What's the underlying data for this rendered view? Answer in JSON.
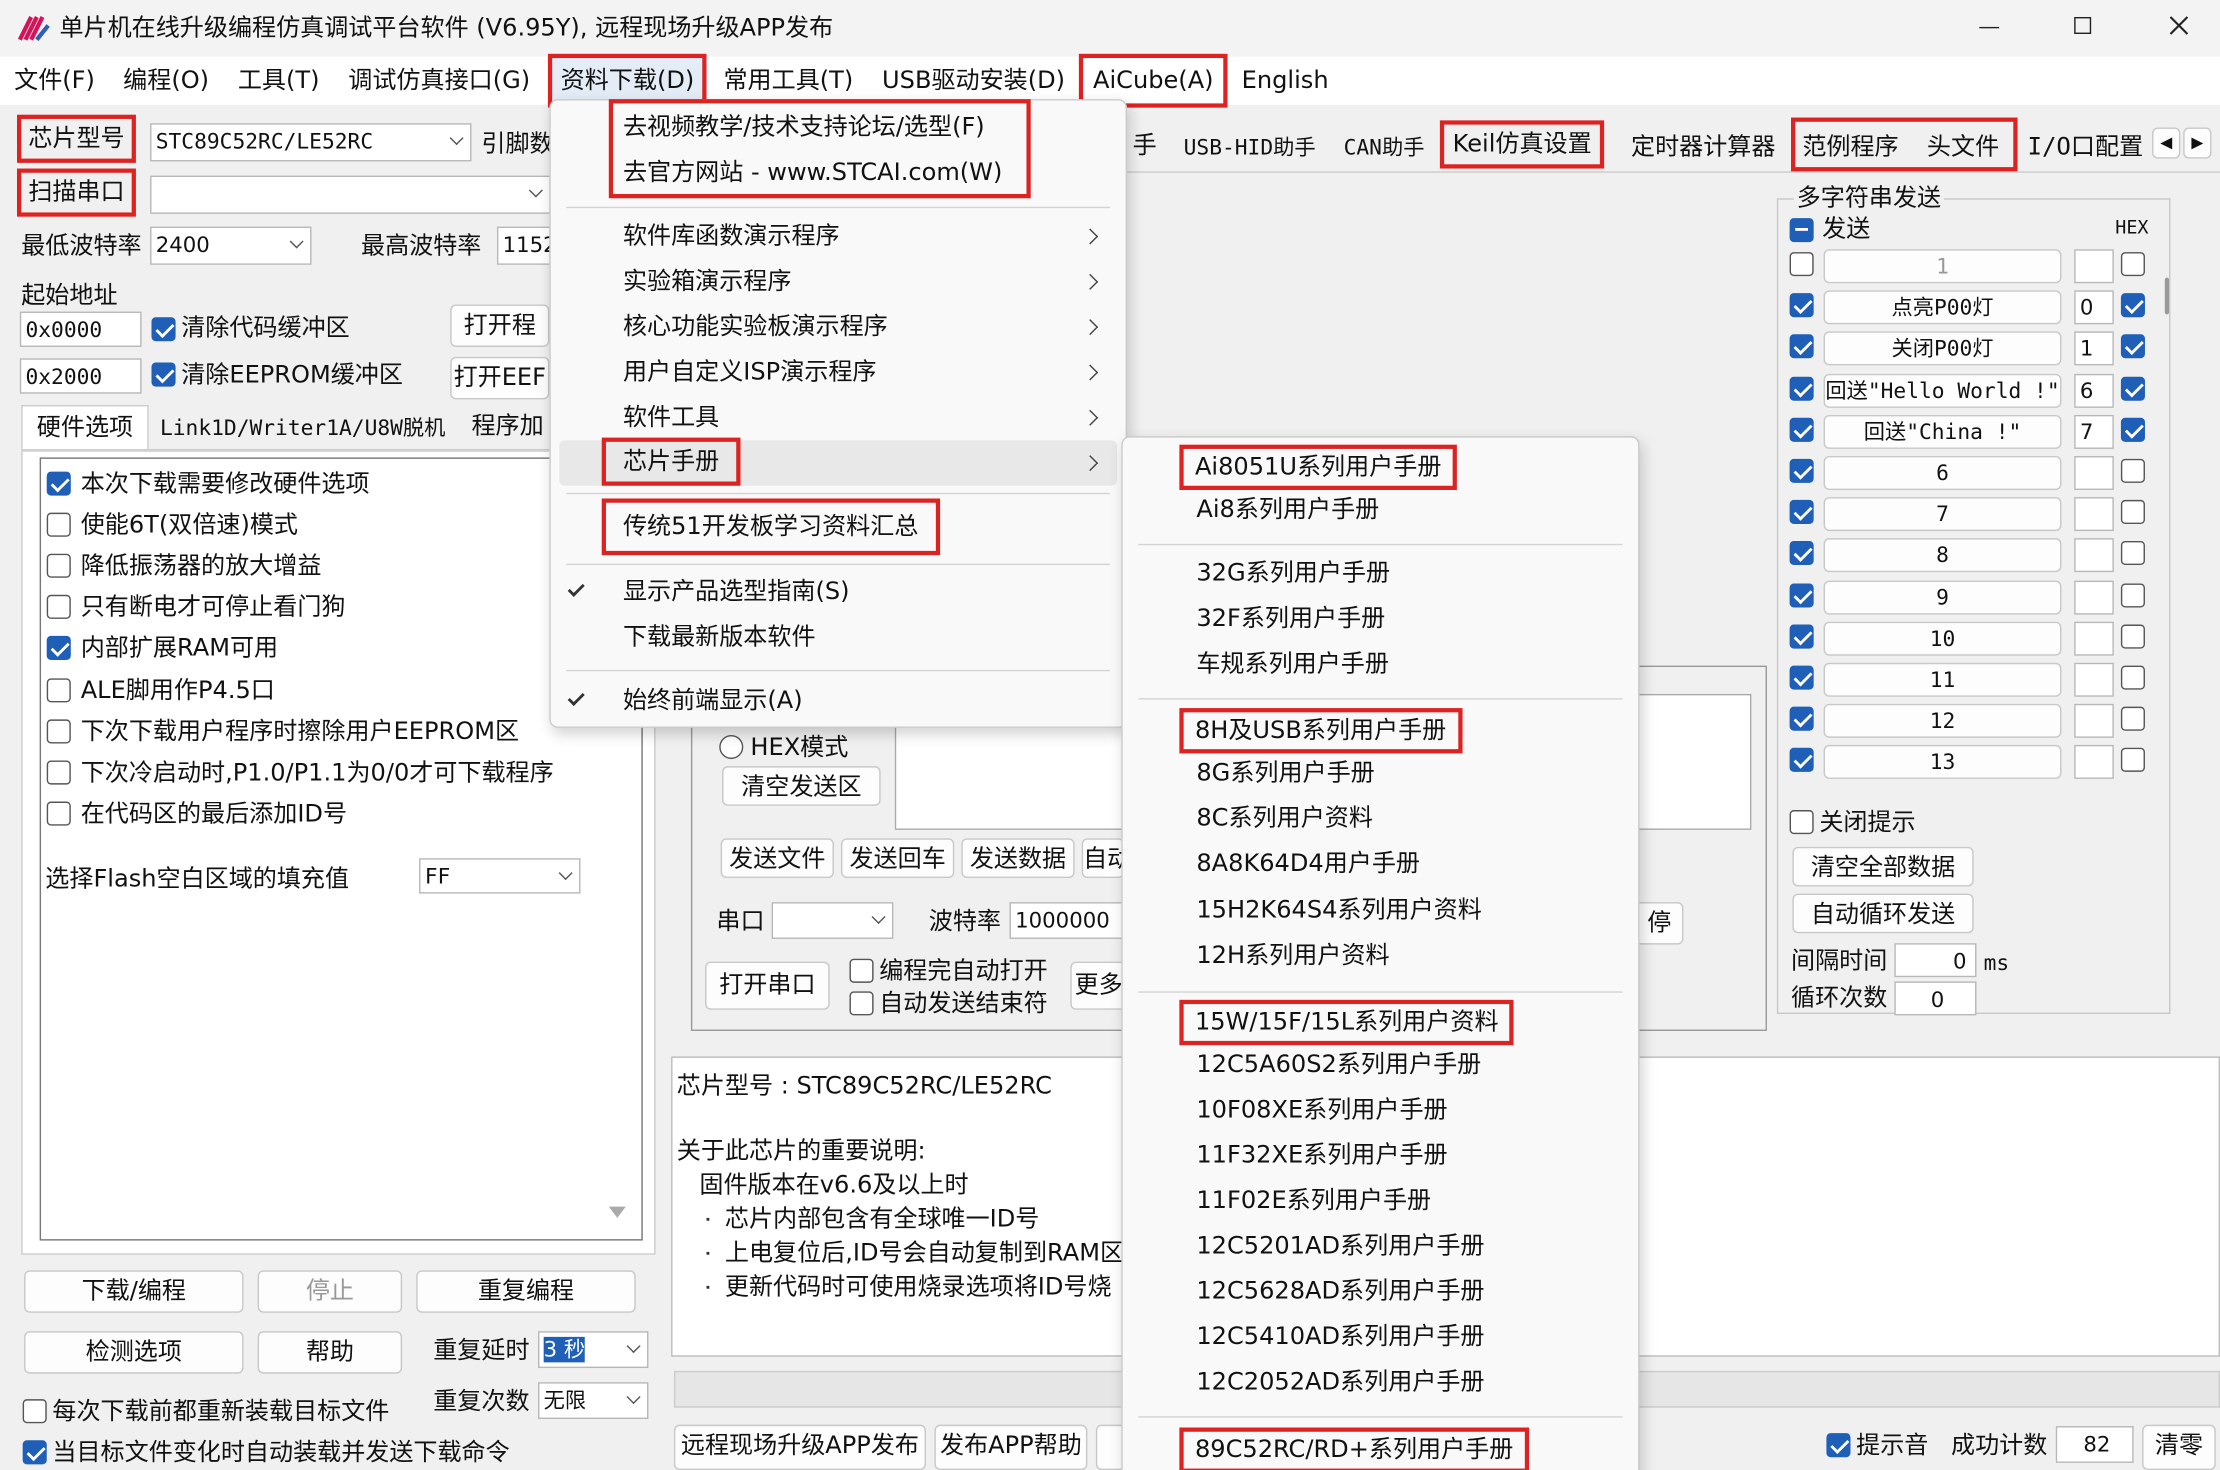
{
  "window": {
    "title": "单片机在线升级编程仿真调试平台软件 (V6.95Y), 远程现场升级APP发布"
  },
  "menubar": [
    "文件(F)",
    "编程(O)",
    "工具(T)",
    "调试仿真接口(G)",
    "资料下载(D)",
    "常用工具(T)",
    "USB驱动安装(D)",
    "AiCube(A)",
    "English"
  ],
  "left": {
    "chip_label": "芯片型号",
    "chip_value": "STC89C52RC/LE52RC",
    "pin_label": "引脚数",
    "scan_label": "扫描串口",
    "min_baud_label": "最低波特率",
    "min_baud": "2400",
    "max_baud_label": "最高波特率",
    "max_baud": "1152",
    "start_addr_label": "起始地址",
    "addr1": "0x0000",
    "clear_code": "清除代码缓冲区",
    "open_prog": "打开程",
    "addr2": "0x2000",
    "clear_eeprom": "清除EEPROM缓冲区",
    "open_eep": "打开EEF",
    "tabs": [
      "硬件选项",
      "Link1D/Writer1A/U8W脱机",
      "程序加"
    ],
    "options": [
      {
        "label": "本次下载需要修改硬件选项",
        "checked": true
      },
      {
        "label": "使能6T(双倍速)模式",
        "checked": false
      },
      {
        "label": "降低振荡器的放大增益",
        "checked": false
      },
      {
        "label": "只有断电才可停止看门狗",
        "checked": false
      },
      {
        "label": "内部扩展RAM可用",
        "checked": true
      },
      {
        "label": "ALE脚用作P4.5口",
        "checked": false
      },
      {
        "label": "下次下载用户程序时擦除用户EEPROM区",
        "checked": false
      },
      {
        "label": "下次冷启动时,P1.0/P1.1为0/0才可下载程序",
        "checked": false
      },
      {
        "label": "在代码区的最后添加ID号",
        "checked": false
      }
    ],
    "fill_label": "选择Flash空白区域的填充值",
    "fill_value": "FF",
    "download": "下载/编程",
    "stop": "停止",
    "reprogram": "重复编程",
    "check_options": "检测选项",
    "help": "帮助",
    "delay_label": "重复延时",
    "delay_value": "3 秒",
    "count_label": "重复次数",
    "count_value": "无限",
    "reload": "每次下载前都重新装载目标文件",
    "auto_send": "当目标文件变化时自动装载并发送下载命令"
  },
  "tabs_right": [
    "手",
    "USB-HID助手",
    "CAN助手",
    "Keil仿真设置",
    "定时器计算器",
    "范例程序",
    "头文件",
    "I/O口配置"
  ],
  "menu": {
    "top": [
      "去视频教学/技术支持论坛/选型(F)",
      "去官方网站 - www.STCAI.com(W)"
    ],
    "subs": [
      "软件库函数演示程序",
      "实验箱演示程序",
      "核心功能实验板演示程序",
      "用户自定义ISP演示程序",
      "软件工具",
      "芯片手册"
    ],
    "legacy": "传统51开发板学习资料汇总",
    "show_guide": "显示产品选型指南(S)",
    "download_latest": "下载最新版本软件",
    "always_top": "始终前端显示(A)"
  },
  "submenu": [
    "Ai8051U系列用户手册",
    "Ai8系列用户手册",
    "32G系列用户手册",
    "32F系列用户手册",
    "车规系列用户手册",
    "8H及USB系列用户手册",
    "8G系列用户手册",
    "8C系列用户资料",
    "8A8K64D4用户手册",
    "15H2K64S4系列用户资料",
    "12H系列用户资料",
    "15W/15F/15L系列用户资料",
    "12C5A60S2系列用户手册",
    "10F08XE系列用户手册",
    "11F32XE系列用户手册",
    "11F02E系列用户手册",
    "12C5201AD系列用户手册",
    "12C5628AD系列用户手册",
    "12C5410AD系列用户手册",
    "12C2052AD系列用户手册",
    "89C52RC/RD+系列用户手册"
  ],
  "serial": {
    "hex_mode": "HEX模式",
    "clear_send": "清空发送区",
    "btns": [
      "发送文件",
      "发送回车",
      "发送数据",
      "自动"
    ],
    "port_label": "串口",
    "baud_label": "波特率",
    "baud_value": "1000000",
    "open": "打开串口",
    "auto_open": "编程完自动打开",
    "auto_end": "自动发送结束符",
    "more": "更多",
    "pause": "停"
  },
  "multi": {
    "title": "多字符串发送",
    "send": "发送",
    "hex": "HEX",
    "rows": [
      {
        "n": "",
        "text": "1",
        "val": "",
        "on": false,
        "hex": false
      },
      {
        "n": "",
        "text": "点亮P00灯",
        "val": "0",
        "on": true,
        "hex": true
      },
      {
        "n": "",
        "text": "关闭P00灯",
        "val": "1",
        "on": true,
        "hex": true
      },
      {
        "n": "",
        "text": "回送\"Hello World !\"",
        "val": "6",
        "on": true,
        "hex": true
      },
      {
        "n": "",
        "text": "回送\"China !\"",
        "val": "7",
        "on": true,
        "hex": true
      },
      {
        "n": "",
        "text": "6",
        "val": "",
        "on": true,
        "hex": false
      },
      {
        "n": "",
        "text": "7",
        "val": "",
        "on": true,
        "hex": false
      },
      {
        "n": "",
        "text": "8",
        "val": "",
        "on": true,
        "hex": false
      },
      {
        "n": "",
        "text": "9",
        "val": "",
        "on": true,
        "hex": false
      },
      {
        "n": "",
        "text": "10",
        "val": "",
        "on": true,
        "hex": false
      },
      {
        "n": "",
        "text": "11",
        "val": "",
        "on": true,
        "hex": false
      },
      {
        "n": "",
        "text": "12",
        "val": "",
        "on": true,
        "hex": false
      },
      {
        "n": "",
        "text": "13",
        "val": "",
        "on": true,
        "hex": false
      }
    ],
    "close_tip": "关闭提示",
    "clear_all": "清空全部数据",
    "auto_loop": "自动循环发送",
    "interval_label": "间隔时间",
    "interval": "0",
    "ms": "ms",
    "loop_label": "循环次数",
    "loop": "0"
  },
  "info": [
    "芯片型号 : STC89C52RC/LE52RC",
    "关于此芯片的重要说明:",
    "固件版本在v6.6及以上时",
    "芯片内部包含有全球唯一ID号",
    "上电复位后,ID号会自动复制到RAM区",
    "更新代码时可使用烧录选项将ID号烧"
  ],
  "bottom": {
    "remote": "远程现场升级APP发布",
    "app_help": "发布APP帮助",
    "tip_sound": "提示音",
    "success_label": "成功计数",
    "success": "82",
    "clear": "清零"
  }
}
